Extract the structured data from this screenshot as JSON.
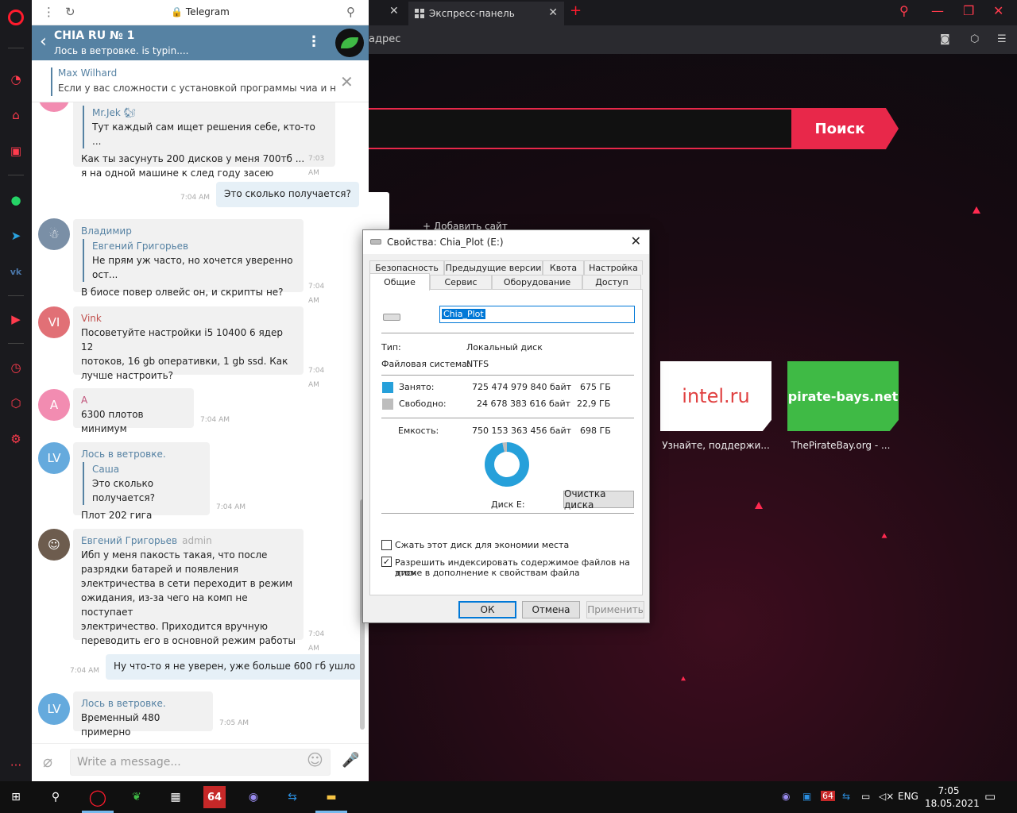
{
  "browser": {
    "active_tab": "Экспресс-панель",
    "address_placeholder": "адрес",
    "search_button": "Поиск",
    "add_site": "+ Добавить сайт",
    "tiles": [
      {
        "label": "intel.ru",
        "caption": "Узнайте, поддержи...",
        "color": "#ffffff"
      },
      {
        "label": "pirate-bays.net",
        "caption": "ThePirateBay.org - ...",
        "color": "#3fba45"
      }
    ],
    "accent": "#e8284a"
  },
  "telegram": {
    "window_title": "Telegram",
    "chat_name": "CHIA RU № 1",
    "chat_status": "Лось в ветровке. is typin....",
    "pinned": {
      "author": "Max Wilhard",
      "text": "Если у вас сложности с установкой программы чиа и настрой..."
    },
    "messages": [
      {
        "sender": "Mr.Jek 🐿",
        "reply_text": "Тут каждый сам ищет решения себе, кто-то ...",
        "lines": [
          "Как ты засунуть 200 дисков у меня 700тб ...",
          "я на одной машине к след году засею"
        ],
        "time": "7:03 AM"
      },
      {
        "out": true,
        "text": "Это сколько получается?",
        "time": "7:04 AM"
      },
      {
        "sender": "Владимир",
        "reply_name": "Евгений Григорьев",
        "reply_text": "Не прям уж часто, но хочется уверенно ост...",
        "lines": [
          "В биосе повер олвейс он, и скрипты не?"
        ],
        "time": "7:04 AM"
      },
      {
        "sender": "Vink",
        "initials": "VI",
        "lines": [
          "Посоветуйте настройки i5 10400 6 ядер 12",
          "потоков, 16 gb оперативки, 1 gb ssd. Как",
          "лучше настроить?"
        ],
        "time": "7:04 AM"
      },
      {
        "sender": "A",
        "initials": "A",
        "lines": [
          "6300 плотов минимум"
        ],
        "time": "7:04 AM"
      },
      {
        "sender": "Лось в ветровке.",
        "initials": "LV",
        "reply_name": "Саша",
        "reply_text": "Это сколько получается?",
        "lines": [
          "Плот 202 гига"
        ],
        "time": "7:04 AM"
      },
      {
        "sender": "Евгений Григорьев",
        "role": "admin",
        "lines": [
          "Ибп у меня пакость такая, что после",
          "разрядки батарей и появления",
          "электричества в сети переходит в режим",
          "ожидания, из-за чего на комп не поступает",
          "электричество. Приходится вручную",
          "переводить его в основной режим работы"
        ],
        "time": "7:04 AM"
      },
      {
        "out": true,
        "text": "Ну что-то я не уверен, уже больше 600 гб ушло",
        "time": "7:04 AM"
      },
      {
        "sender": "Лось в ветровке.",
        "initials": "LV",
        "lines": [
          "Временный 480 примерно"
        ],
        "time": "7:05 AM"
      }
    ],
    "input_placeholder": "Write a message...",
    "header_color": "#5682a3"
  },
  "dialog": {
    "title": "Свойства: Chia_Plot (E:)",
    "tabs_top": [
      "Безопасность",
      "Предыдущие версии",
      "Квота",
      "Настройка"
    ],
    "tabs_bottom": [
      "Общие",
      "Сервис",
      "Оборудование",
      "Доступ"
    ],
    "name_value": "Chia_Plot",
    "type_label": "Тип:",
    "type_value": "Локальный диск",
    "fs_label": "Файловая система:",
    "fs_value": "NTFS",
    "used_label": "Занято:",
    "used_bytes": "725 474 979 840 байт",
    "used_gb": "675 ГБ",
    "free_label": "Свободно:",
    "free_bytes": "24 678 383 616 байт",
    "free_gb": "22,9 ГБ",
    "cap_label": "Емкость:",
    "cap_bytes": "750 153 363 456 байт",
    "cap_gb": "698 ГБ",
    "used_fraction": 0.967,
    "drive_label": "Диск E:",
    "cleanup": "Очистка диска",
    "compress": "Сжать этот диск для экономии места",
    "index": "Разрешить индексировать содержимое файлов на этом",
    "index2": "диске в дополнение к свойствам файла",
    "ok": "ОК",
    "cancel": "Отмена",
    "apply": "Применить",
    "used_color": "#26a0da",
    "free_color": "#bdbdbd"
  },
  "taskbar": {
    "lang": "ENG",
    "time": "7:05",
    "date": "18.05.2021",
    "badge": "64"
  }
}
